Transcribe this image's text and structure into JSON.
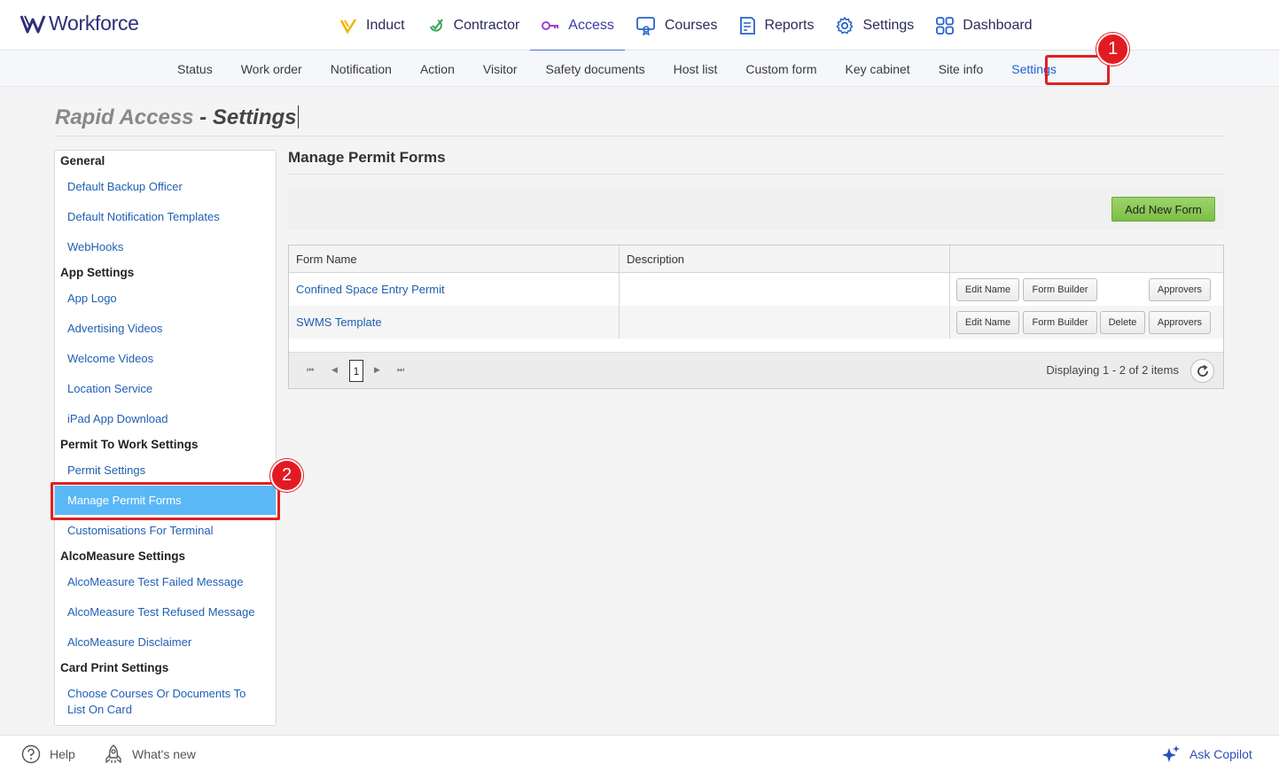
{
  "app": {
    "name": "Workforce"
  },
  "mainnav": [
    {
      "label": "Induct",
      "icon": "induct-icon"
    },
    {
      "label": "Contractor",
      "icon": "contractor-icon"
    },
    {
      "label": "Access",
      "icon": "access-key-icon",
      "active": true
    },
    {
      "label": "Courses",
      "icon": "courses-icon"
    },
    {
      "label": "Reports",
      "icon": "reports-icon"
    },
    {
      "label": "Settings",
      "icon": "gear-icon"
    },
    {
      "label": "Dashboard",
      "icon": "dashboard-grid-icon"
    }
  ],
  "subnav": [
    {
      "label": "Status"
    },
    {
      "label": "Work order"
    },
    {
      "label": "Notification"
    },
    {
      "label": "Action"
    },
    {
      "label": "Visitor"
    },
    {
      "label": "Safety documents"
    },
    {
      "label": "Host list"
    },
    {
      "label": "Custom form"
    },
    {
      "label": "Key cabinet"
    },
    {
      "label": "Site info"
    },
    {
      "label": "Settings",
      "active": true
    }
  ],
  "annotations": {
    "badge1": "1",
    "badge2": "2"
  },
  "page": {
    "title_light": "Rapid Access",
    "title_sep": " - ",
    "title_strong": "Settings"
  },
  "sidebar": {
    "groups": [
      {
        "label": "General",
        "items": [
          "Default Backup Officer",
          "Default Notification Templates",
          "WebHooks"
        ]
      },
      {
        "label": "App Settings",
        "items": [
          "App Logo",
          "Advertising Videos",
          "Welcome Videos",
          "Location Service",
          "iPad App Download"
        ]
      },
      {
        "label": "Permit To Work Settings",
        "items": [
          "Permit Settings",
          "Manage Permit Forms",
          "Customisations For Terminal"
        ]
      },
      {
        "label": "AlcoMeasure Settings",
        "items": [
          "AlcoMeasure Test Failed Message",
          "AlcoMeasure Test Refused Message",
          "AlcoMeasure Disclaimer"
        ]
      },
      {
        "label": "Card Print Settings",
        "items": [
          "Choose Courses Or Documents To",
          "List On Card"
        ]
      }
    ],
    "selected": "Manage Permit Forms"
  },
  "main": {
    "title": "Manage Permit Forms",
    "add_button": "Add New Form",
    "columns": [
      "Form Name",
      "Description",
      ""
    ],
    "rows": [
      {
        "name": "Confined Space Entry Permit",
        "description": "",
        "actions": [
          "Edit Name",
          "Form Builder",
          "Approvers"
        ]
      },
      {
        "name": "SWMS Template",
        "description": "",
        "actions": [
          "Edit Name",
          "Form Builder",
          "Delete",
          "Approvers"
        ]
      }
    ],
    "pager": {
      "page": "1",
      "info": "Displaying 1 - 2 of 2 items"
    }
  },
  "footer": {
    "help": "Help",
    "whats_new": "What's new",
    "copilot": "Ask Copilot"
  },
  "colors": {
    "accent": "#1f5fd1",
    "brand": "#2e2e7a",
    "selected": "#5bb8f7",
    "highlight": "#e02020",
    "add_button": "#8ccb57"
  }
}
